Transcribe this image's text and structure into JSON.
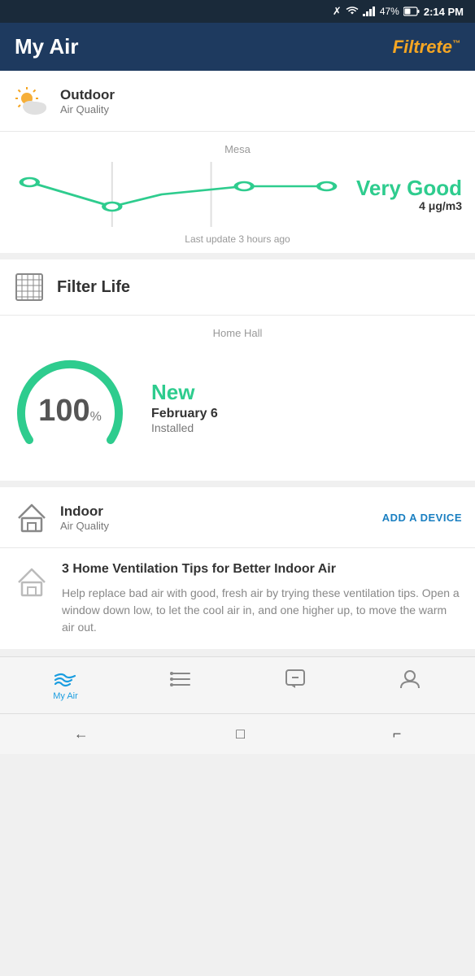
{
  "statusBar": {
    "battery": "47%",
    "time": "2:14 PM"
  },
  "header": {
    "title": "My Air",
    "brand": "Filtrete",
    "brandTm": "™"
  },
  "outdoor": {
    "sectionMainLabel": "Outdoor",
    "sectionSubLabel": "Air Quality",
    "location": "Mesa",
    "readingLabel": "Very Good",
    "readingValue": "4 μg/m3",
    "lastUpdate": "Last update 3 hours ago"
  },
  "filterLife": {
    "sectionTitle": "Filter Life",
    "location": "Home Hall",
    "percentage": "100",
    "percentSign": "%",
    "statusLabel": "New",
    "installedDate": "February 6",
    "installedText": "Installed"
  },
  "indoor": {
    "sectionMainLabel": "Indoor",
    "sectionSubLabel": "Air Quality",
    "addDeviceLabel": "ADD A DEVICE"
  },
  "tip": {
    "title": "3 Home Ventilation Tips for Better Indoor Air",
    "text": "Help replace bad air with good, fresh air by trying these ventilation tips.\n Open a window down low, to let the cool air in, and one higher up, to move the warm air out."
  },
  "bottomNav": {
    "items": [
      {
        "id": "my-air",
        "label": "My Air",
        "active": true
      },
      {
        "id": "list",
        "label": "",
        "active": false
      },
      {
        "id": "info",
        "label": "",
        "active": false
      },
      {
        "id": "profile",
        "label": "",
        "active": false
      }
    ]
  },
  "androidNav": {
    "back": "←",
    "home": "□",
    "recent": "⌐"
  }
}
